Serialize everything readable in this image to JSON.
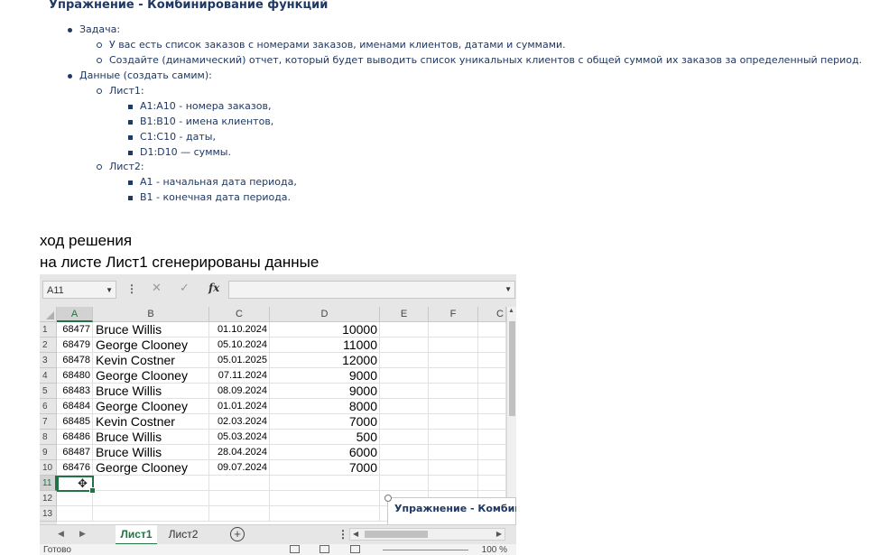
{
  "exercise": {
    "title": "Упражнение - Комбинирование функций",
    "task_label": "Задача:",
    "task_items": [
      "У вас есть список заказов с номерами заказов, именами клиентов, датами и суммами.",
      "Создайте (динамический) отчет, который будет выводить список уникальных клиентов с общей суммой их заказов за определенный период."
    ],
    "data_label": "Данные (создать самим):",
    "sheet1_label": "Лист1:",
    "sheet1_items": [
      "A1:A10 - номера заказов,",
      "B1:B10 - имена клиентов,",
      "C1:C10 - даты,",
      "D1:D10 — суммы."
    ],
    "sheet2_label": "Лист2:",
    "sheet2_items": [
      "A1 - начальная дата периода,",
      "B1 - конечная дата периода."
    ]
  },
  "solution": {
    "line1": "ход решения",
    "line2": "на листе Лист1 сгенерированы данные"
  },
  "excel": {
    "name_box": "A11",
    "fx_label": "fx",
    "columns": [
      "A",
      "B",
      "C",
      "D",
      "E",
      "F",
      "C"
    ],
    "row_numbers": [
      "1",
      "2",
      "3",
      "4",
      "5",
      "6",
      "7",
      "8",
      "9",
      "10",
      "11",
      "12",
      "13"
    ],
    "rows": [
      {
        "a": "68477",
        "b": "Bruce Willis",
        "c": "01.10.2024",
        "d": "10000"
      },
      {
        "a": "68479",
        "b": "George Clooney",
        "c": "05.10.2024",
        "d": "11000"
      },
      {
        "a": "68478",
        "b": "Kevin Costner",
        "c": "05.01.2025",
        "d": "12000"
      },
      {
        "a": "68480",
        "b": "George Clooney",
        "c": "07.11.2024",
        "d": "9000"
      },
      {
        "a": "68483",
        "b": "Bruce Willis",
        "c": "08.09.2024",
        "d": "9000"
      },
      {
        "a": "68484",
        "b": "George Clooney",
        "c": "01.01.2024",
        "d": "8000"
      },
      {
        "a": "68485",
        "b": "Kevin Costner",
        "c": "02.03.2024",
        "d": "7000"
      },
      {
        "a": "68486",
        "b": "Bruce Willis",
        "c": "05.03.2024",
        "d": "500"
      },
      {
        "a": "68487",
        "b": "Bruce Willis",
        "c": "28.04.2024",
        "d": "6000"
      },
      {
        "a": "68476",
        "b": "George Clooney",
        "c": "09.07.2024",
        "d": "7000"
      }
    ],
    "overlay_text": "Упражнение - Комбин",
    "tabs": [
      "Лист1",
      "Лист2"
    ],
    "status": "Готово",
    "zoom": "100 %"
  }
}
